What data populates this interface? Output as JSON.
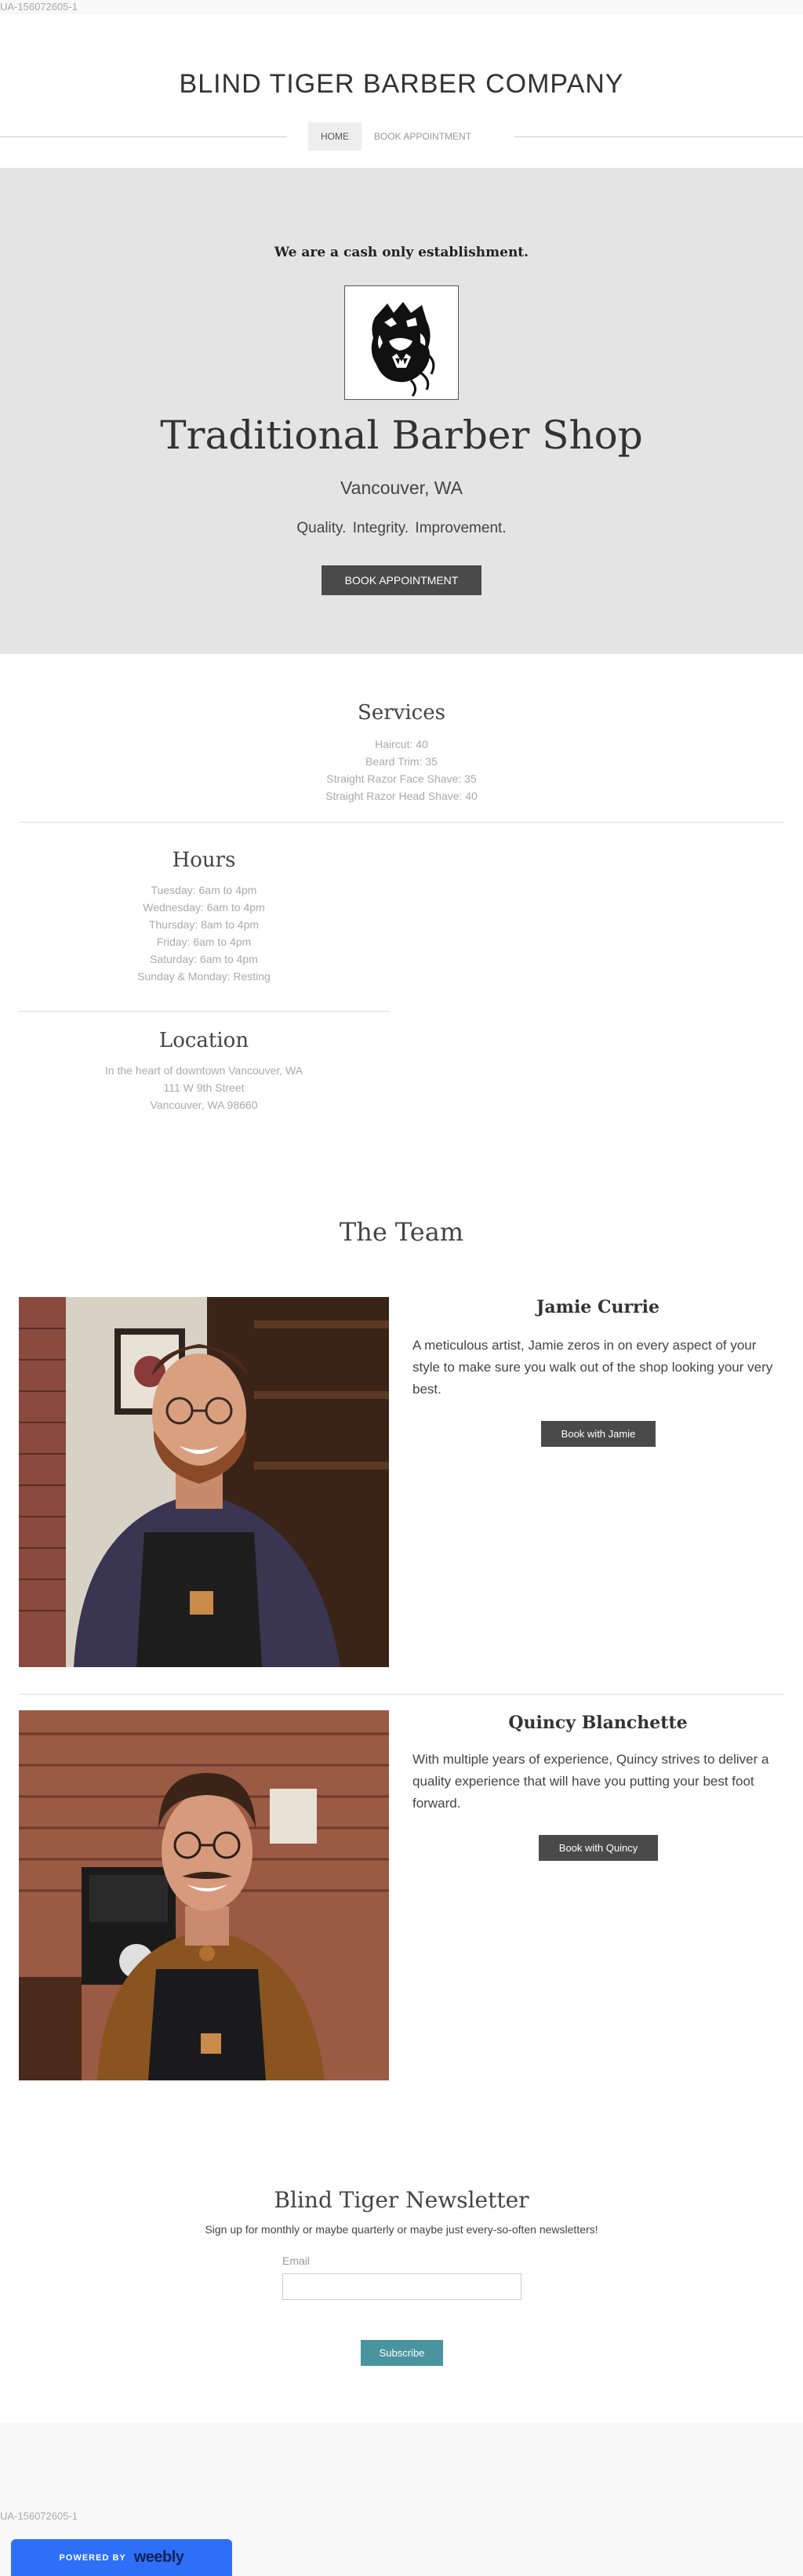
{
  "tracking_code": "UA-156072605-1",
  "header": {
    "site_title": "BLIND TIGER BARBER COMPANY",
    "nav": [
      {
        "label": "HOME",
        "active": true
      },
      {
        "label": "BOOK APPOINTMENT",
        "active": false
      }
    ]
  },
  "hero": {
    "notice": "We are a cash only establishment.",
    "logo_icon": "tiger-head-logo",
    "title": "Traditional Barber Shop",
    "subtitle": "Vancouver, WA",
    "tagline": "Quality.  Integrity.  Improvement.",
    "button_label": "BOOK APPOINTMENT",
    "background_color": "#e4e4e4"
  },
  "services": {
    "title": "Services",
    "items": [
      "Haircut: 40",
      "Beard Trim: 35",
      "Straight Razor Face Shave: 35",
      "Straight Razor Head Shave: 40"
    ]
  },
  "hours": {
    "title": "Hours",
    "items": [
      "Tuesday: 6am to 4pm",
      "Wednesday: 6am to 4pm",
      "Thursday: 8am to 4pm",
      "Friday: 6am to 4pm",
      "Saturday: 6am to 4pm",
      "Sunday & Monday: Resting"
    ]
  },
  "location": {
    "title": "Location",
    "lines": [
      "In the heart of downtown Vancouver, WA",
      "111 W 9th Street",
      "Vancouver, WA 98660"
    ]
  },
  "team": {
    "title": "The Team",
    "members": [
      {
        "name": "Jamie Currie",
        "bio": " A meticulous artist, Jamie zeros in on every aspect of your style to make sure you walk out of the shop looking your very best.",
        "button_label": "Book with Jamie"
      },
      {
        "name": "Quincy Blanchette",
        "bio": "With multiple years of experience, Quincy strives to deliver a quality experience that will have you putting your best foot forward.",
        "button_label": "Book with Quincy"
      }
    ]
  },
  "newsletter": {
    "title": "Blind Tiger Newsletter",
    "description": "Sign up for monthly or maybe quarterly or maybe just every-so-often newsletters!",
    "email_label": "Email",
    "email_value": "",
    "subscribe_label": "Subscribe",
    "accent_color": "#4a94a0"
  },
  "footer": {
    "badge_powered": "POWERED BY",
    "badge_brand": "weebly",
    "badge_color": "#2e6ff7"
  }
}
